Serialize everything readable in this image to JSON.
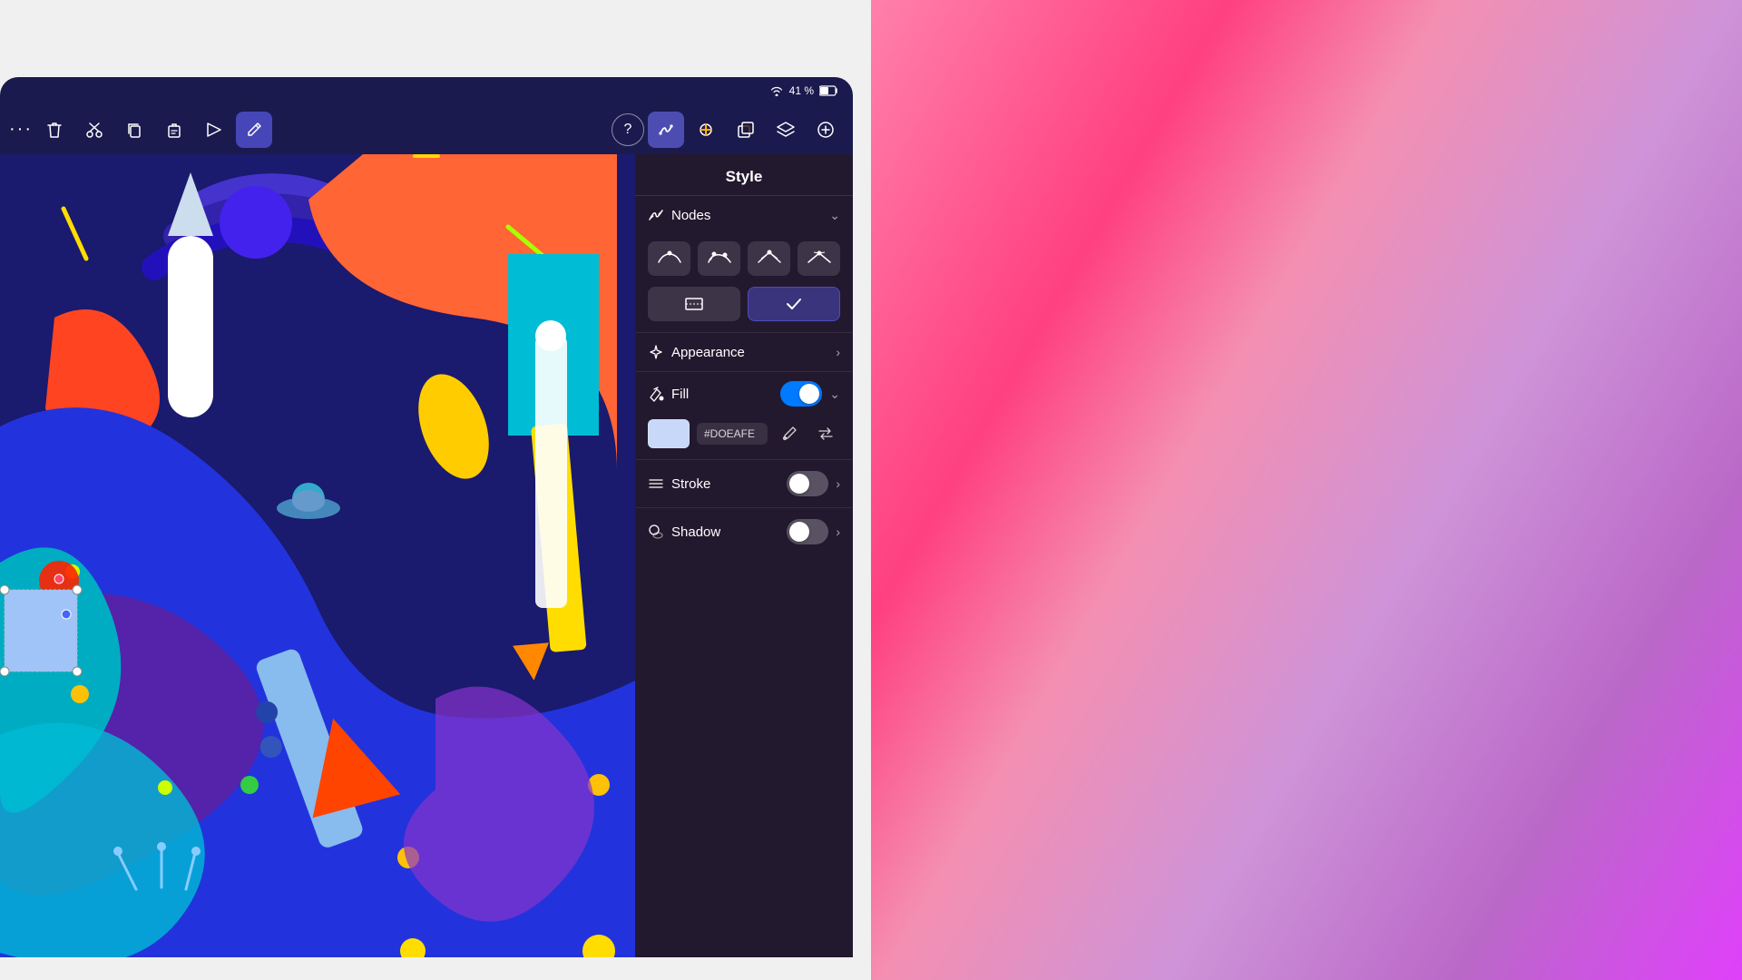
{
  "device": {
    "status_bar": {
      "wifi_icon": "wifi",
      "battery_percent": "41 %",
      "battery_icon": "battery"
    }
  },
  "toolbar": {
    "more_dots": "···",
    "left_buttons": [
      {
        "id": "delete",
        "icon": "🗑",
        "label": "delete-button"
      },
      {
        "id": "cut",
        "icon": "✂",
        "label": "cut-button"
      },
      {
        "id": "copy",
        "icon": "⎘",
        "label": "copy-button"
      },
      {
        "id": "paste",
        "icon": "📋",
        "label": "paste-button"
      },
      {
        "id": "mirror",
        "icon": "⊞",
        "label": "mirror-button"
      },
      {
        "id": "undo",
        "icon": "↩",
        "label": "undo-button"
      }
    ],
    "right_buttons": [
      {
        "id": "help",
        "icon": "?",
        "label": "help-button"
      },
      {
        "id": "nodes",
        "icon": "✦",
        "label": "nodes-button",
        "active": true
      },
      {
        "id": "style",
        "icon": "◇",
        "label": "style-button"
      },
      {
        "id": "duplicate",
        "icon": "⧉",
        "label": "duplicate-button"
      },
      {
        "id": "layers",
        "icon": "⊕",
        "label": "layers-button"
      },
      {
        "id": "add",
        "icon": "+",
        "label": "add-button"
      }
    ]
  },
  "panel": {
    "title": "Style",
    "nodes_section": {
      "label": "Nodes",
      "expanded": true,
      "node_types": [
        {
          "id": "smooth",
          "icon": "smooth"
        },
        {
          "id": "asymmetric",
          "icon": "asym"
        },
        {
          "id": "cusp",
          "icon": "cusp"
        },
        {
          "id": "corner",
          "icon": "corner"
        }
      ],
      "row2": [
        {
          "id": "rect-node",
          "icon": "rect",
          "active": false
        },
        {
          "id": "check-node",
          "icon": "check",
          "active": true
        }
      ]
    },
    "appearance_section": {
      "label": "Appearance",
      "has_chevron": true
    },
    "fill_section": {
      "label": "Fill",
      "enabled": true,
      "color_hex": "#DOEAFE",
      "color_display": "#DOEAFE",
      "color_swatch_bg": "#c8d8f8"
    },
    "stroke_section": {
      "label": "Stroke",
      "enabled": false
    },
    "shadow_section": {
      "label": "Shadow",
      "enabled": false
    }
  }
}
